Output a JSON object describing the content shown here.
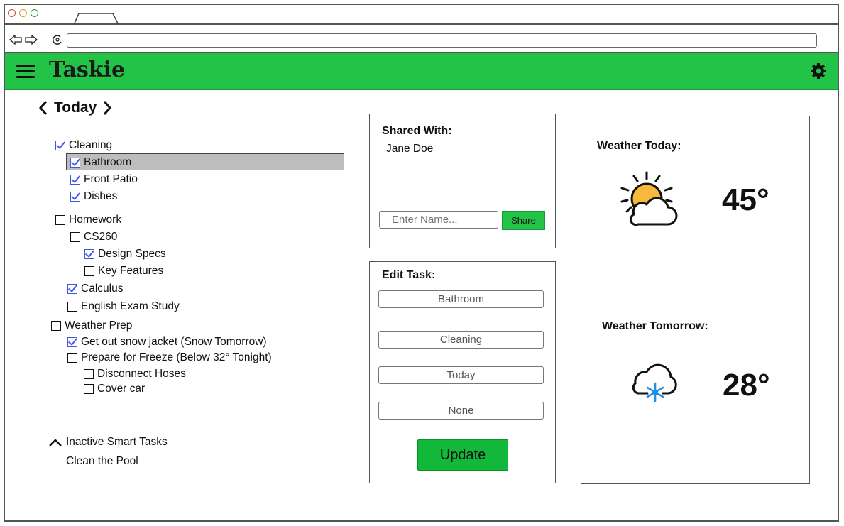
{
  "app": {
    "title": "Taskie"
  },
  "browser": {
    "url": ""
  },
  "colors": {
    "header_green": "#22c347",
    "check_blue": "#4a55ff",
    "update_green": "#12b83a"
  },
  "nav": {
    "day_label": "Today"
  },
  "tasks": [
    {
      "label": "Cleaning",
      "checked": true
    },
    {
      "label": "Bathroom",
      "checked": true,
      "selected": true
    },
    {
      "label": "Front Patio",
      "checked": true
    },
    {
      "label": "Dishes",
      "checked": true
    },
    {
      "label": "Homework",
      "checked": false
    },
    {
      "label": "CS260",
      "checked": false
    },
    {
      "label": "Design Specs",
      "checked": true
    },
    {
      "label": "Key Features",
      "checked": false
    },
    {
      "label": "Calculus",
      "checked": true
    },
    {
      "label": "English Exam Study",
      "checked": false
    },
    {
      "label": "Weather Prep",
      "checked": false
    },
    {
      "label": "Get out snow jacket  (Snow Tomorrow)",
      "checked": true
    },
    {
      "label": "Prepare for Freeze  (Below 32° Tonight)",
      "checked": false
    },
    {
      "label": "Disconnect Hoses",
      "checked": false
    },
    {
      "label": "Cover car",
      "checked": false
    }
  ],
  "inactive": {
    "label": "Inactive Smart Tasks",
    "items": [
      "Clean the Pool"
    ]
  },
  "shared": {
    "title": "Shared With:",
    "people": [
      "Jane Doe"
    ],
    "input_placeholder": "Enter Name...",
    "share_label": "Share"
  },
  "edit": {
    "title": "Edit Task:",
    "fields": [
      "Bathroom",
      "Cleaning",
      "Today",
      "None"
    ],
    "update_label": "Update"
  },
  "weather": {
    "today_label": "Weather Today:",
    "today_temp": "45°",
    "today_icon": "partly-sunny-icon",
    "tomorrow_label": "Weather Tomorrow:",
    "tomorrow_temp": "28°",
    "tomorrow_icon": "snow-cloud-icon"
  }
}
